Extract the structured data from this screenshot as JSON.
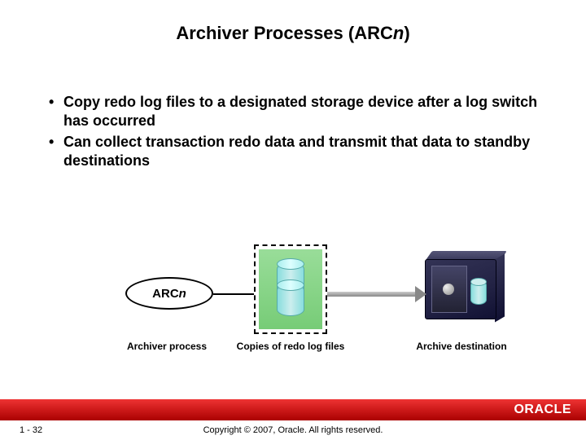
{
  "title_prefix": "Archiver Processes (ARC",
  "title_n": "n",
  "title_suffix": ")",
  "bullets": [
    "Copy redo log files to a designated storage device after a log switch has occurred",
    "Can collect transaction redo data and transmit that data to standby destinations"
  ],
  "diagram": {
    "arcn_prefix": "ARC",
    "arcn_n": "n",
    "caption_process": "Archiver process",
    "caption_redo": "Copies of redo log files",
    "caption_dest": "Archive destination"
  },
  "footer": {
    "logo": "ORACLE",
    "page": "1 - 32",
    "copyright": "Copyright © 2007, Oracle. All rights reserved."
  }
}
